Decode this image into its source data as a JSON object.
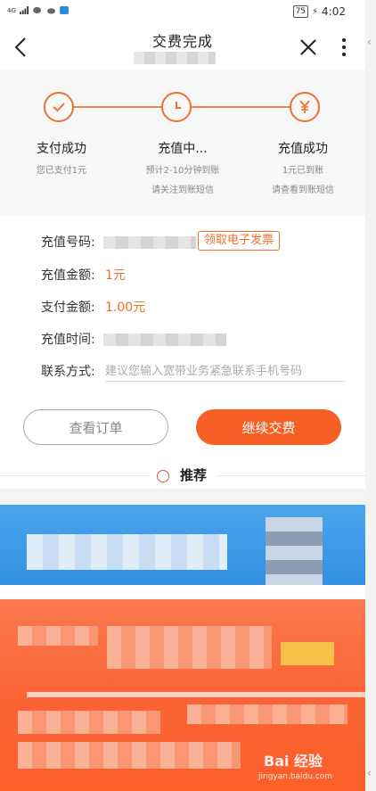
{
  "status_bar": {
    "network": "4G",
    "battery": "75",
    "time": "4:02"
  },
  "nav": {
    "title": "交费完成"
  },
  "progress": {
    "steps": [
      {
        "title": "支付成功",
        "desc_line1": "您已支付1元",
        "desc_line2": ""
      },
      {
        "title": "充值中...",
        "desc_line1": "预计2-10分钟到账",
        "desc_line2": "请关注到账短信"
      },
      {
        "title": "充值成功",
        "desc_line1": "1元已到账",
        "desc_line2": "请查看到账短信"
      }
    ],
    "accent_color": "#f0712e"
  },
  "info": {
    "number_label": "充值号码:",
    "invoice_button": "领取电子发票",
    "amount_label": "充值金额:",
    "amount_value": "1元",
    "paid_label": "支付金额:",
    "paid_value": "1.00元",
    "time_label": "充值时间:",
    "contact_label": "联系方式:",
    "contact_placeholder": "建议您输入宽带业务紧急联系手机号码"
  },
  "actions": {
    "view_order": "查看订单",
    "continue_pay": "继续交费"
  },
  "recommend": {
    "title": "推荐"
  },
  "watermark": {
    "brand": "Bai 经验",
    "url": "jingyan.baidu.com"
  }
}
